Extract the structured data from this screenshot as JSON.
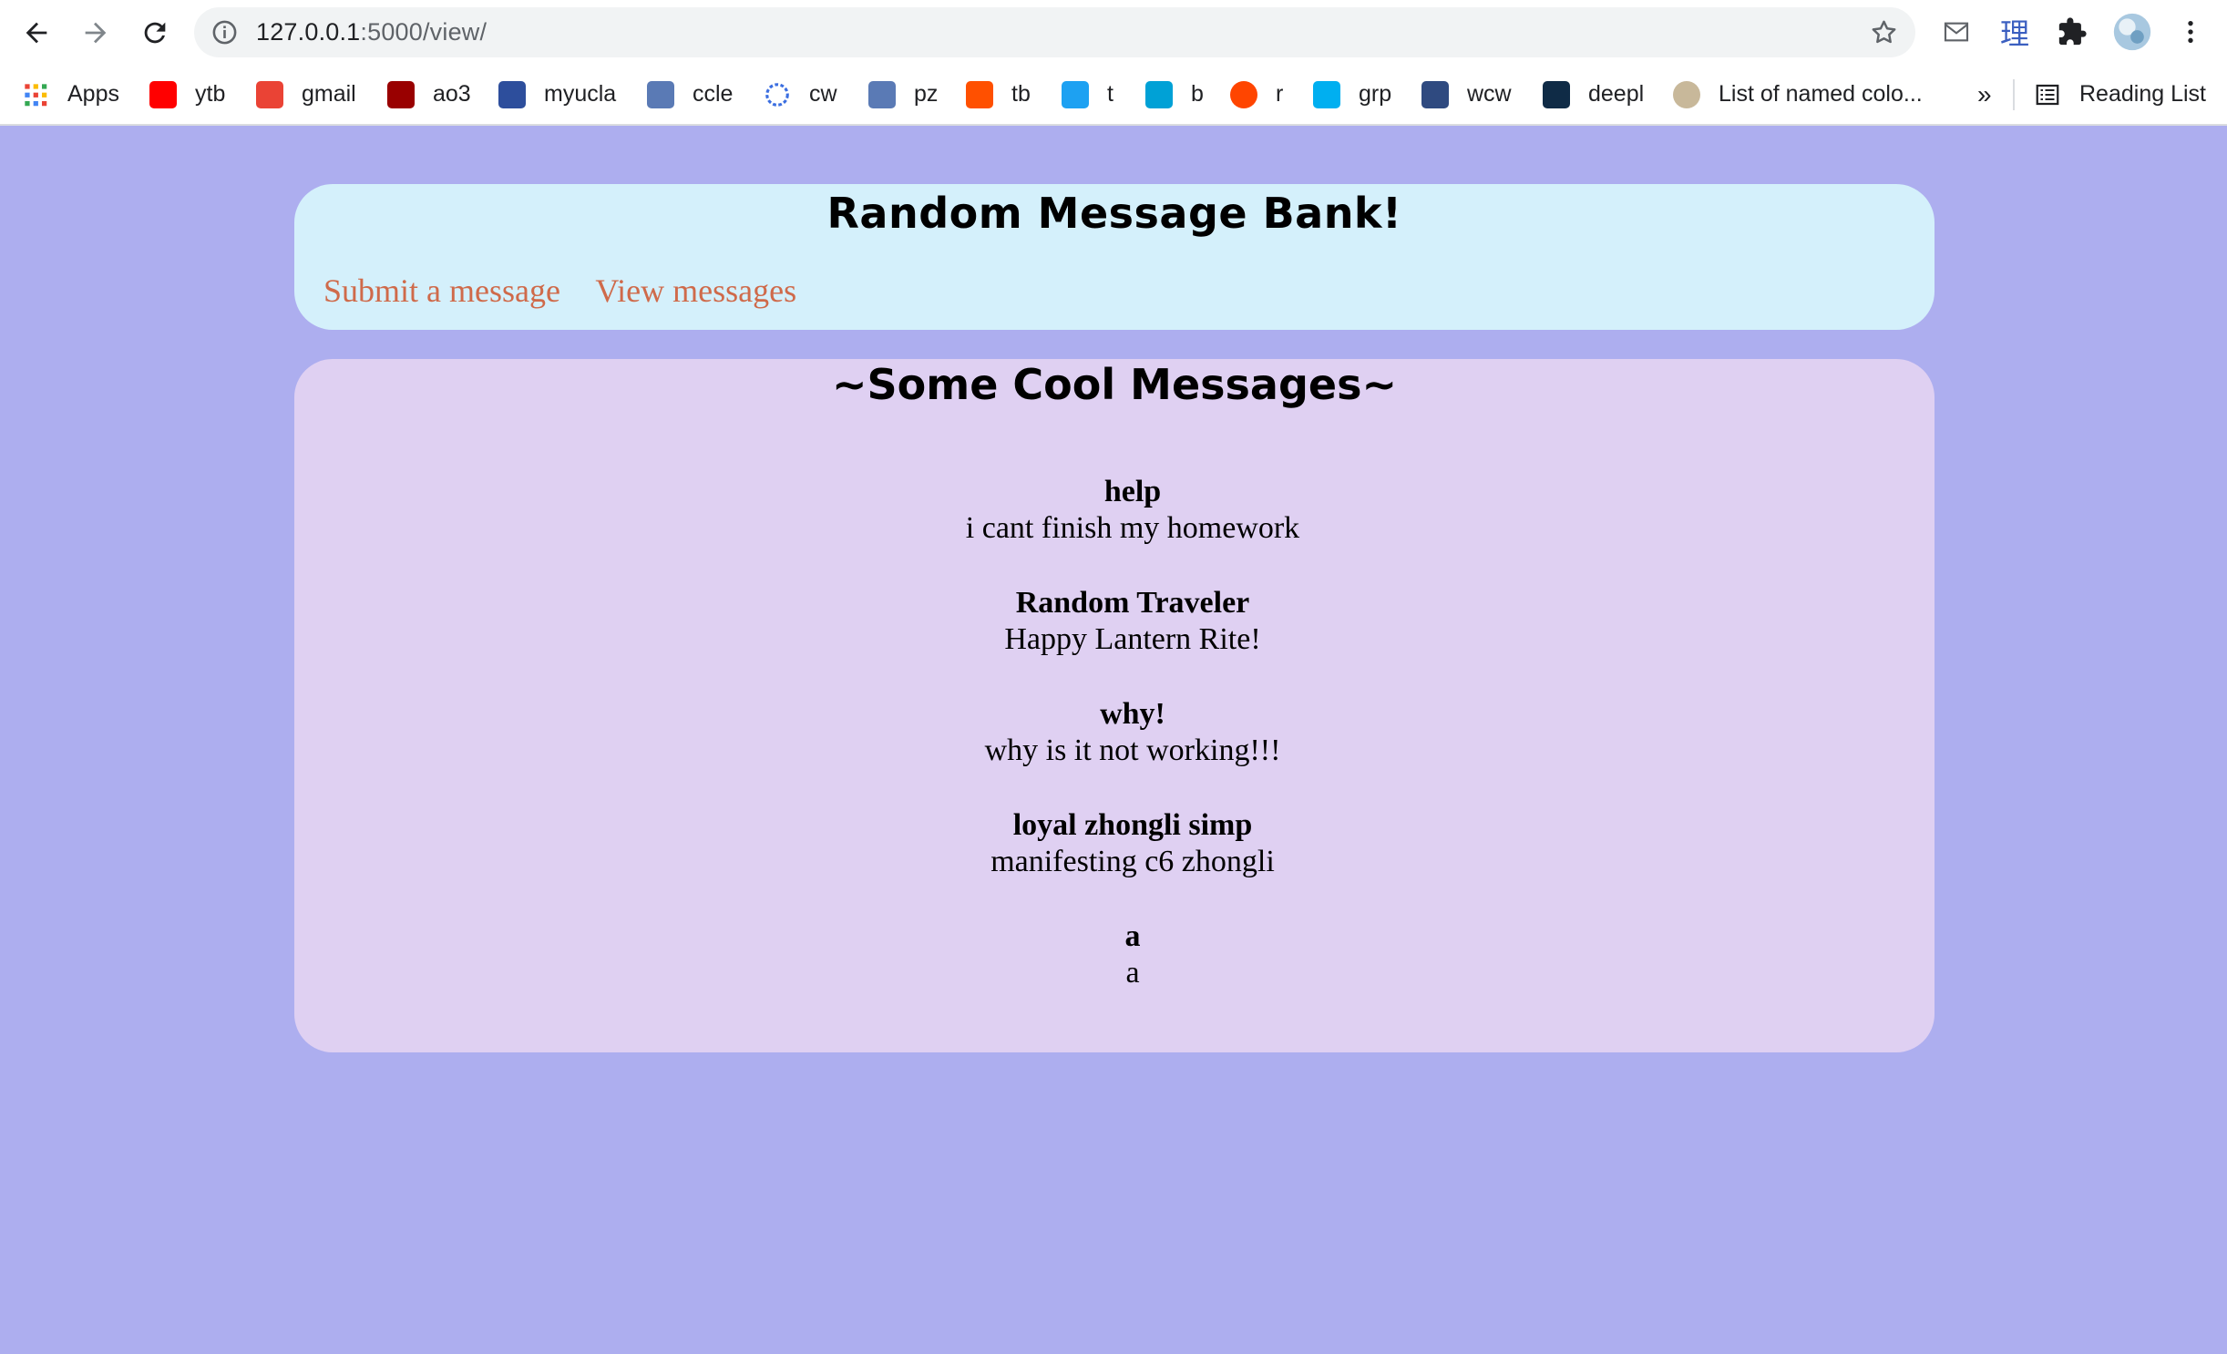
{
  "browser": {
    "url_host": "127.0.0.1",
    "url_path": ":5000/view/",
    "extension_label": "理"
  },
  "bookmarks": [
    {
      "label": "Apps",
      "icon": "apps-grid-icon",
      "color": "#4285f4"
    },
    {
      "label": "ytb",
      "icon": "youtube-icon",
      "color": "#ff0000"
    },
    {
      "label": "gmail",
      "icon": "gmail-icon",
      "color": "#ea4335"
    },
    {
      "label": "ao3",
      "icon": "ao3-icon",
      "color": "#990000"
    },
    {
      "label": "myucla",
      "icon": "myucla-icon",
      "color": "#2d4e9c"
    },
    {
      "label": "ccle",
      "icon": "ccle-icon",
      "color": "#5a7ab5"
    },
    {
      "label": "cw",
      "icon": "cw-icon",
      "color": "#3b6ee0"
    },
    {
      "label": "pz",
      "icon": "pz-icon",
      "color": "#5a7ab5"
    },
    {
      "label": "tb",
      "icon": "taobao-icon",
      "color": "#ff5000"
    },
    {
      "label": "t",
      "icon": "twitter-icon",
      "color": "#1da1f2"
    },
    {
      "label": "b",
      "icon": "bilibili-icon",
      "color": "#00a1d6"
    },
    {
      "label": "r",
      "icon": "reddit-icon",
      "color": "#ff4500"
    },
    {
      "label": "grp",
      "icon": "groupme-icon",
      "color": "#00aff0"
    },
    {
      "label": "wcw",
      "icon": "wcw-icon",
      "color": "#2f4a80"
    },
    {
      "label": "deepl",
      "icon": "deepl-icon",
      "color": "#0f2b46"
    },
    {
      "label": "List of named colo...",
      "icon": "wikipedia-icon",
      "color": "#c8b89a"
    }
  ],
  "reading_list_label": "Reading List",
  "overflow_label": "»",
  "header": {
    "title": "Random Message Bank!",
    "nav": [
      "Submit a message",
      "View messages"
    ]
  },
  "section": {
    "title": "~Some Cool Messages~"
  },
  "messages": [
    {
      "author": "help",
      "text": "i cant finish my homework"
    },
    {
      "author": "Random Traveler",
      "text": "Happy Lantern Rite!"
    },
    {
      "author": "why!",
      "text": "why is it not working!!!"
    },
    {
      "author": "loyal zhongli simp",
      "text": "manifesting c6 zhongli"
    },
    {
      "author": "a",
      "text": "a"
    }
  ],
  "colors": {
    "page_background": "#adaeef",
    "header_card": "#d4f0fb",
    "messages_card": "#dfd0f2",
    "link": "#cf6a4a"
  }
}
